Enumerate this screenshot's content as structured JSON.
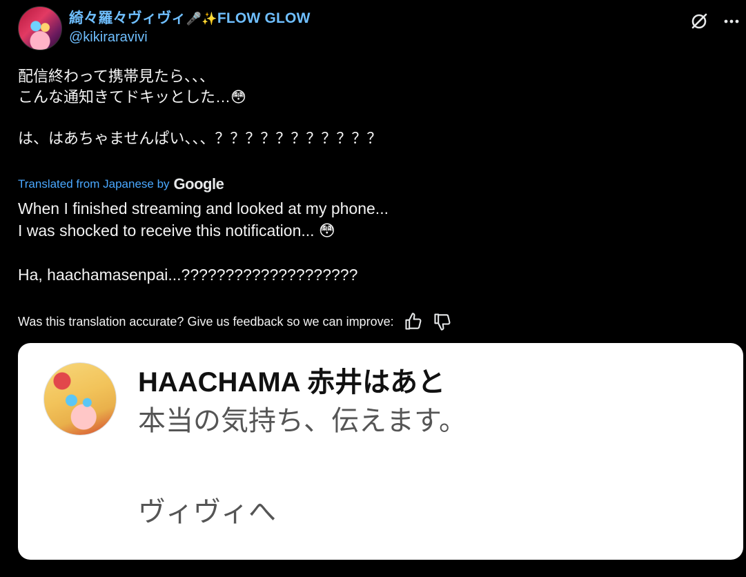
{
  "tweet": {
    "display_name": "綺々羅々ヴィヴィ",
    "name_suffix": "FLOW GLOW",
    "name_emojis": "🎤✨",
    "handle": "@kikiraravivi",
    "text_jp": "配信終わって携帯見たら、、、\nこんな通知きてドキッとした…😳\n\nは、はあちゃませんぱい、、、？？？？？？？？？？？",
    "translated_label": "Translated from Japanese by",
    "translator": "Google",
    "text_en": "When I finished streaming and looked at my phone...\nI was shocked to receive this notification... 😳\n\nHa, haachamasenpai...????????????????????",
    "feedback_prompt": "Was this translation accurate? Give us feedback so we can improve:"
  },
  "notification": {
    "sender": "HAACHAMA 赤井はあと",
    "line1": "本当の気持ち、伝えます。",
    "line2": "ヴィヴィへ"
  },
  "icons": {
    "grok": "grok-icon",
    "more": "more-icon",
    "thumbs_up": "thumbs-up-icon",
    "thumbs_down": "thumbs-down-icon"
  },
  "colors": {
    "background": "#000000",
    "name": "#6fbfff",
    "link": "#4aa8ff",
    "card": "#ffffff"
  }
}
